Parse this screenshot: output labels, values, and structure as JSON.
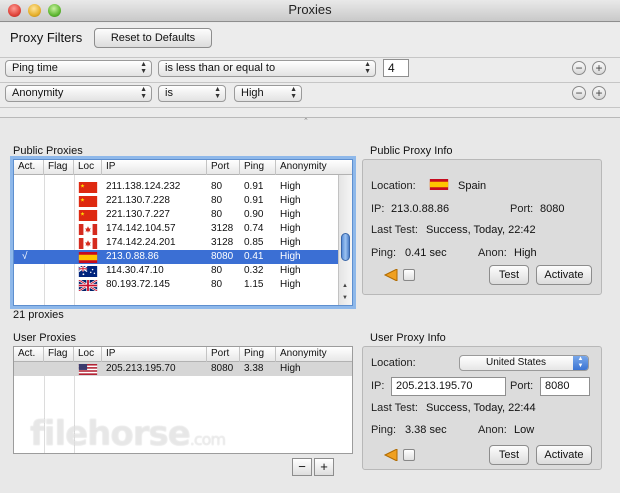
{
  "window": {
    "title": "Proxies"
  },
  "filters": {
    "title": "Proxy Filters",
    "reset_label": "Reset to Defaults",
    "rows": [
      {
        "field": "Ping time",
        "operator": "is less than or equal to",
        "value": "4"
      },
      {
        "field": "Anonymity",
        "operator": "is",
        "value": "High"
      }
    ],
    "remove_symbol": "−",
    "add_symbol": "+"
  },
  "public": {
    "label": "Public Proxies",
    "count_label": "21 proxies",
    "columns": [
      "Act.",
      "Flag",
      "Loc",
      "IP",
      "Port",
      "Ping",
      "Anonymity"
    ],
    "rows": [
      {
        "act": "",
        "flag": "china",
        "ip": "211.138.124.232",
        "port": "80",
        "ping": "0.91",
        "anonymity": "High"
      },
      {
        "act": "",
        "flag": "china",
        "ip": "221.130.7.228",
        "port": "80",
        "ping": "0.91",
        "anonymity": "High"
      },
      {
        "act": "",
        "flag": "china",
        "ip": "221.130.7.227",
        "port": "80",
        "ping": "0.90",
        "anonymity": "High"
      },
      {
        "act": "",
        "flag": "canada",
        "ip": "174.142.104.57",
        "port": "3128",
        "ping": "0.74",
        "anonymity": "High"
      },
      {
        "act": "",
        "flag": "canada",
        "ip": "174.142.24.201",
        "port": "3128",
        "ping": "0.85",
        "anonymity": "High"
      },
      {
        "act": "√",
        "flag": "spain",
        "ip": "213.0.88.86",
        "port": "8080",
        "ping": "0.41",
        "anonymity": "High",
        "selected": true
      },
      {
        "act": "",
        "flag": "australia",
        "ip": "114.30.47.10",
        "port": "80",
        "ping": "0.32",
        "anonymity": "High"
      },
      {
        "act": "",
        "flag": "uk",
        "ip": "80.193.72.145",
        "port": "80",
        "ping": "1.15",
        "anonymity": "High"
      }
    ]
  },
  "public_info": {
    "title": "Public Proxy Info",
    "location_label": "Location:",
    "location": "Spain",
    "ip_label": "IP:",
    "ip": "213.0.88.86",
    "port_label": "Port:",
    "port": "8080",
    "lasttest_label": "Last Test:",
    "lasttest": "Success, Today, 22:42",
    "ping_label": "Ping:",
    "ping": "0.41 sec",
    "anon_label": "Anon:",
    "anon": "High",
    "test_label": "Test",
    "activate_label": "Activate"
  },
  "user": {
    "label": "User Proxies",
    "columns": [
      "Act.",
      "Flag",
      "Loc",
      "IP",
      "Port",
      "Ping",
      "Anonymity"
    ],
    "rows": [
      {
        "act": "",
        "flag": "usa",
        "ip": "205.213.195.70",
        "port": "8080",
        "ping": "3.38",
        "anonymity": "High"
      }
    ],
    "remove_symbol": "−",
    "add_symbol": "+"
  },
  "user_info": {
    "title": "User Proxy Info",
    "location_label": "Location:",
    "location": "United States",
    "ip_label": "IP:",
    "ip": "205.213.195.70",
    "port_label": "Port:",
    "port": "8080",
    "lasttest_label": "Last Test:",
    "lasttest": "Success, Today, 22:44",
    "ping_label": "Ping:",
    "ping": "3.38 sec",
    "anon_label": "Anon:",
    "anon": "Low",
    "test_label": "Test",
    "activate_label": "Activate"
  },
  "watermark": {
    "text": "filehorse",
    "suffix": ".com"
  },
  "colors": {
    "selection": "#3b6fd4",
    "focus_ring": "#8eb8ea"
  }
}
